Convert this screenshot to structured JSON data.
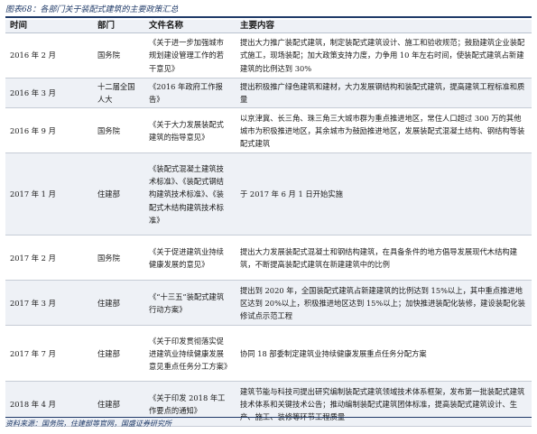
{
  "caption": "图表68：各部门关于装配式建筑的主要政策汇总",
  "headers": {
    "time": "时间",
    "dept": "部门",
    "doc": "文件名称",
    "content": "主要内容"
  },
  "rows": [
    {
      "time": "2016 年 2 月",
      "dept": "国务院",
      "doc": "《关于进一步加强城市规划建设管理工作的若干意见》",
      "content": "提出大力推广装配式建筑，制定装配式建筑设计、施工和验收规范；鼓励建筑企业装配式施工，现场装配；加大政策支持力度，力争用 10 年左右时间，使装配式建筑占新建建筑的比例达到 30%"
    },
    {
      "time": "2016 年 3 月",
      "dept": "十二届全国人大",
      "doc": "《2016 年政府工作报告》",
      "content": "提出积极推广绿色建筑和建材，大力发展钢结构和装配式建筑，提高建筑工程标准和质量"
    },
    {
      "time": "2016 年 9 月",
      "dept": "国务院",
      "doc": "《关于大力发展装配式建筑的指导意见》",
      "content": "以京津冀、长三角、珠三角三大城市群为重点推进地区，常住人口超过 300 万的其他城市为积极推进地区，其余城市为鼓励推进地区，发展装配式混凝土结构、钢结构等装配式建筑"
    },
    {
      "time": "2017 年 1 月",
      "dept": "住建部",
      "doc": "《装配式混凝土建筑技术标准》、《装配式钢结构建筑技术标准》、《装配式木结构建筑技术标准》",
      "content": "于 2017 年 6 月 1 日开始实施"
    },
    {
      "time": "2017 年 2 月",
      "dept": "国务院",
      "doc": "《关于促进建筑业持续健康发展的意见》",
      "content": "提出大力发展装配式混凝土和钢结构建筑，在具备条件的地方倡导发展现代木结构建筑，不断提高装配式建筑在新建建筑中的比例"
    },
    {
      "time": "2017 年 3 月",
      "dept": "住建部",
      "doc": "《“十三五”装配式建筑行动方案》",
      "content": "提出到 2020 年，全国装配式建筑占新建建筑的比例达到 15%以上，其中重点推进地区达到 20%以上，积极推进地区达到 15%以上；加快推进装配化装修，建设装配化装修试点示范工程"
    },
    {
      "time": "2017 年 7 月",
      "dept": "住建部",
      "doc": "《关于印发贯彻落实促进建筑业持续健康发展意见重点任务分工方案》",
      "content": "协同 18 部委制定建筑业持续健康发展重点任务分配方案"
    },
    {
      "time": "2018 年 4 月",
      "dept": "住建部",
      "doc": "《关于印发 2018 年工作要点的通知》",
      "content": "建筑节能与科技司提出研究编制装配式建筑领域技术体系框架，发布第一批装配式建筑技术体系和关键技术公告；推动编制装配式建筑团体标准，提高装配式建筑设计、生产、施工、装修等环节工程质量"
    }
  ],
  "source": "资料来源：国务院，住建部等官网，国盛证券研究所"
}
